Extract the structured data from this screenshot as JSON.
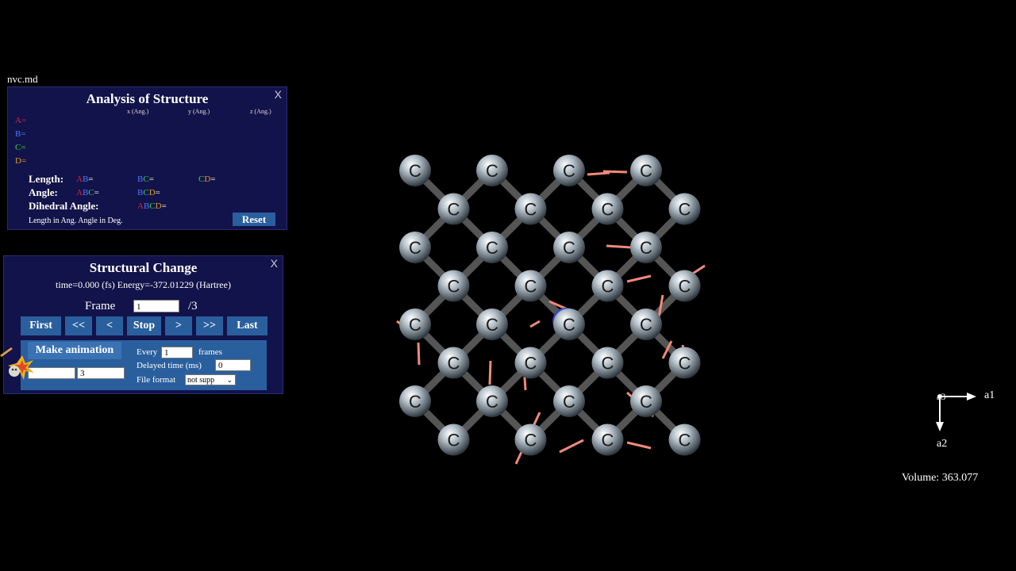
{
  "filename": "nvc.md",
  "analysis": {
    "title": "Analysis of Structure",
    "close": "X",
    "axis_headers": [
      "x (Ang.)",
      "y (Ang.)",
      "z (Ang.)"
    ],
    "points": [
      "A=",
      "B=",
      "C=",
      "D="
    ],
    "length_label": "Length:",
    "angle_label": "Angle:",
    "dihedral_label": "Dihedral Angle:",
    "note": "Length in Ang. Angle in Deg.",
    "reset_label": "Reset"
  },
  "structural": {
    "title": "Structural Change",
    "close": "X",
    "status": "time=0.000 (fs) Energy=-372.01229 (Hartree)",
    "frame_label": "Frame",
    "frame_value": "1",
    "frame_total": "/3",
    "nav": [
      "First",
      "<<",
      "<",
      "Stop",
      ">",
      ">>",
      "Last"
    ],
    "make_animation": "Make animation",
    "every_label": "Every",
    "every_value": "1",
    "frames_label": "frames",
    "delay_label": "Delayed time (ms)",
    "delay_value": "0",
    "range_end_value": "3",
    "file_format_label": "File format",
    "file_format_value": "not supp"
  },
  "scene": {
    "atom_label": "C",
    "atom_color": "#8d9aa4",
    "bond_color": "#555555",
    "force_color": "#f08a7a",
    "selected_color": "#2233cc"
  },
  "axes": {
    "a1": "a1",
    "a2": "a2",
    "a3": "a3"
  },
  "volume": "Volume: 363.077"
}
